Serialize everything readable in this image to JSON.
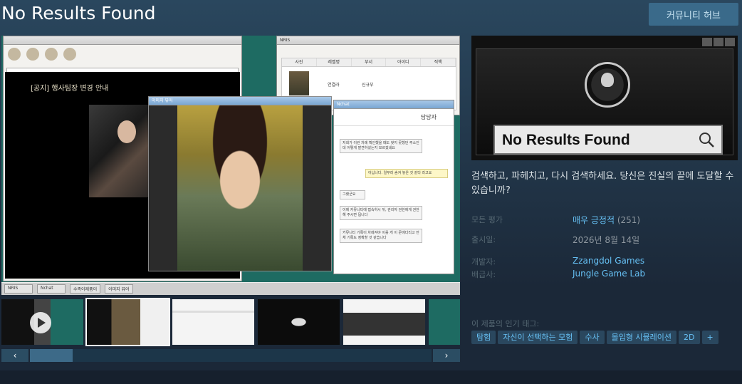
{
  "page": {
    "title": "No Results Found",
    "hub_button": "커뮤니티 허브"
  },
  "media": {
    "browser_notice": "[공지] 행사팀장 변경 안내",
    "nrs_title": "NRIS",
    "nrs_columns": [
      "사진",
      "레벨명",
      "부서",
      "아이디",
      "직책"
    ],
    "nrs_row": [
      "",
      "연결라",
      "신규부",
      "",
      ""
    ],
    "photo_window_title": "이미지 뷰어",
    "chat_title": "Nchat",
    "chat_header": "담당자",
    "chat_messages": [
      "저희가 이런 차례 확인했을 때도 찾지 못했던 주소인데 어떻게 발견하셨는지 모르겠네요",
      "아닙니다. 일부러 숨겨 놓은 것 같다 라고요",
      "그랬군요",
      "이제 커뮤니티에 접속하시 뒤, 관리자 권한에게 권한해 주시면 됩니다",
      "커뮤니티 기록이 차례져야 이를 게 이 문에다리고 전체 기록도 정확할 것 같습니다"
    ],
    "taskbar_items": [
      "NRIS",
      "Nchat",
      "수족이제품이",
      "이미지 뷰어"
    ]
  },
  "capsule": {
    "search_text": "No Results Found"
  },
  "description": "검색하고, 파헤치고, 다시 검색하세요. 당신은 진실의 끝에 도달할 수 있습니까?",
  "meta": {
    "reviews_label": "모든 평가",
    "reviews_value": "매우 긍정적",
    "reviews_count": "(251)",
    "release_label": "출시일:",
    "release_value": "2026년 8월 14일",
    "developer_label": "개발자:",
    "developer_value": "Zzangdol Games",
    "publisher_label": "배급사:",
    "publisher_value": "Jungle Game Lab"
  },
  "tags_label": "이 제품의 인기 태그:",
  "tags": [
    "탐험",
    "자신이 선택하는 모험",
    "수사",
    "몰입형 시뮬레이션",
    "2D",
    "+"
  ],
  "scroll": {
    "left": "‹",
    "right": "›"
  }
}
